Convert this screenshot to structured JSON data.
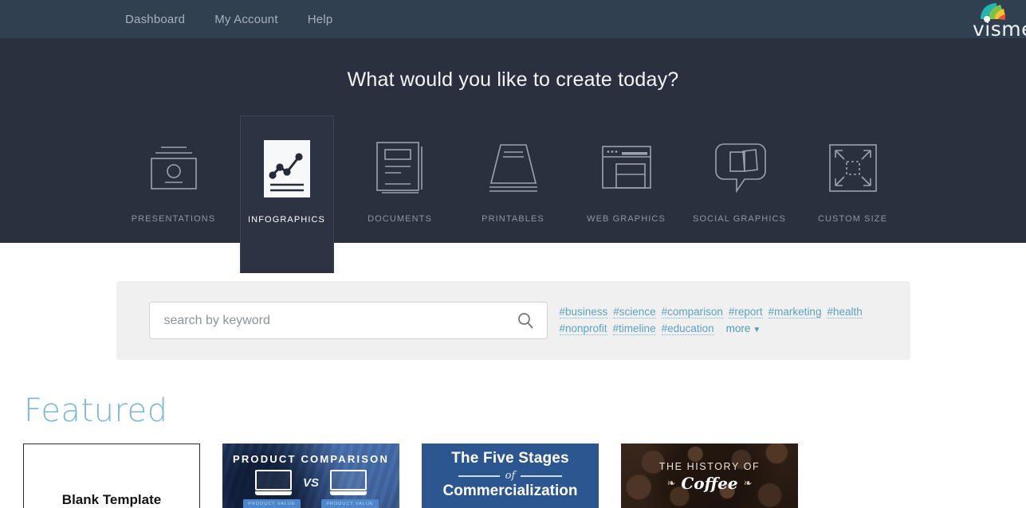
{
  "brand": {
    "logo_word": "visme",
    "logo_colors": [
      "#23b6b0",
      "#7cc14a",
      "#f2c230",
      "#e8523f"
    ]
  },
  "topnav": {
    "items": [
      {
        "label": "Dashboard"
      },
      {
        "label": "My Account"
      },
      {
        "label": "Help"
      }
    ],
    "bg": "#304050",
    "link_color": "#a7b0bb"
  },
  "hero": {
    "title": "What would you like to create today?",
    "bg": "#2b303e",
    "categories": [
      {
        "label": "PRESENTATIONS",
        "icon": "presentation-icon",
        "selected": false
      },
      {
        "label": "INFOGRAPHICS",
        "icon": "infographic-icon",
        "selected": true
      },
      {
        "label": "DOCUMENTS",
        "icon": "documents-icon",
        "selected": false
      },
      {
        "label": "PRINTABLES",
        "icon": "printable-icon",
        "selected": false
      },
      {
        "label": "WEB GRAPHICS",
        "icon": "browser-icon",
        "selected": false
      },
      {
        "label": "SOCIAL GRAPHICS",
        "icon": "speech-bubble-icon",
        "selected": false
      },
      {
        "label": "CUSTOM SIZE",
        "icon": "resize-arrows-icon",
        "selected": false
      }
    ]
  },
  "search": {
    "placeholder": "search by keyword",
    "value": "",
    "icon": "search-icon",
    "panel_bg": "#f0f0f1",
    "tag_color": "#5ba3bd",
    "tags": [
      "#business",
      "#science",
      "#comparison",
      "#report",
      "#marketing",
      "#health",
      "#nonprofit",
      "#timeline",
      "#education"
    ],
    "more_label": "more",
    "more_caret": "▼"
  },
  "featured": {
    "heading": "Featured",
    "heading_color": "#7ab8d4",
    "cards": [
      {
        "kind": "blank",
        "title": "Blank Template"
      },
      {
        "kind": "product-comparison",
        "title": "PRODUCT COMPARISON",
        "vs_label": "VS",
        "button_left": "PRODUCT VALUE",
        "button_right": "PRODUCT VALUE"
      },
      {
        "kind": "five-stages",
        "line1": "The Five Stages",
        "connector": "of",
        "line2": "Commercialization"
      },
      {
        "kind": "history-of-coffee",
        "line1": "THE HISTORY OF",
        "line2": "Coffee",
        "leaf_left": "❧",
        "leaf_right": "❧"
      }
    ]
  }
}
